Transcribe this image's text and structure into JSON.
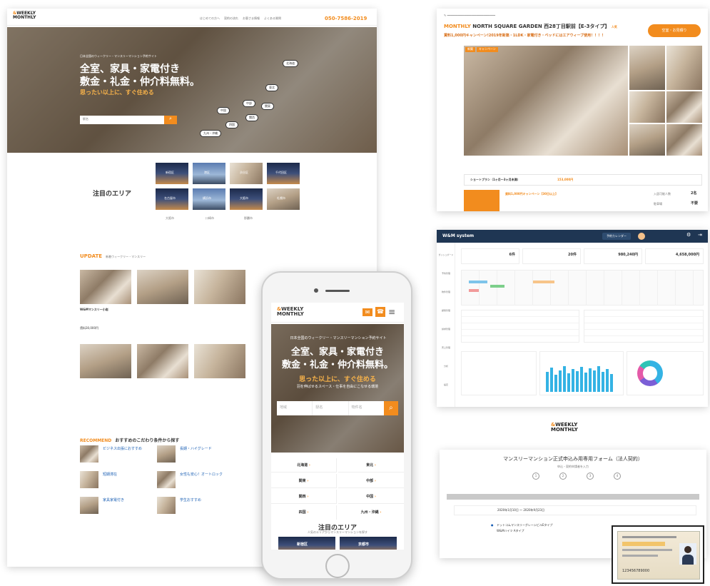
{
  "colors": {
    "accent": "#f28c1e",
    "dark": "#1f3653",
    "brand_orange": "#f28c1e"
  },
  "desktop": {
    "logo_top": "WEEKLY",
    "logo_bottom": "MONTHLY",
    "nav": [
      "はじめての方へ",
      "契約の流れ",
      "お客さま情報",
      "よくある質問"
    ],
    "phone": "050-7586-2019",
    "hero_small": "日本全国のウィークリー・マンスリーマンション予約サイト",
    "hero_line1": "全室、家具・家電付き",
    "hero_line2": "敷金・礼金・仲介料無料。",
    "hero_sub": "思ったい以上に、すぐ住める",
    "search_placeholder": "駅名",
    "map_pins": [
      "北海道",
      "東北",
      "関東",
      "中部",
      "関西",
      "中国",
      "四国",
      "九州・沖縄"
    ],
    "area_title": "注目のエリア",
    "area_tiles": [
      "新宿区",
      "港区",
      "渋谷区",
      "千代田区",
      "名古屋市",
      "横浜市",
      "大阪市",
      "札幌市"
    ],
    "area_links": [
      "大阪市",
      "川崎市",
      "那覇市"
    ],
    "update_label": "UPDATE",
    "update_title": "新着ウィークリー・マンスリー",
    "listing_name": "W&Mマンスリー小岩",
    "listing_price": "賃料30,000円",
    "recommend_label": "RECOMMEND",
    "recommend_title": "おすすめのこだわり条件から探す",
    "rec_items": [
      "ビジネス出張におすすめ",
      "長期・ハイグレード",
      "短期滞在",
      "女性も安心！オートロック",
      "家具家電付き",
      "学生おすすめ"
    ]
  },
  "mobile": {
    "logo_top": "WEEKLY",
    "logo_bottom": "MONTHLY",
    "hero_small": "日本全国のウィークリー・マンスリーマンション予約サイト",
    "hero_line1": "全室、家具・家電付き",
    "hero_line2": "敷金・礼金・仲介料無料。",
    "hero_sub": "思った以上に、すぐ住める",
    "hero_caption": "羽を伸ばせるスペース・仕事を自由にこなせる環境",
    "search_fields": [
      "地域",
      "駅名",
      "物件名"
    ],
    "regions": [
      [
        "北海道",
        "東北"
      ],
      [
        "関東",
        "中部"
      ],
      [
        "関西",
        "中国"
      ],
      [
        "四国",
        "九州・沖縄"
      ]
    ],
    "area_title": "注目のエリア",
    "area_sub": "人気のエリアからマンスリーマンションを探す",
    "area_tiles": [
      "新宿区",
      "京都市"
    ]
  },
  "detail": {
    "label": "MONTHLY",
    "title": "NORTH SQUARE GARDEN 西28丁目駅前【E-3タイプ】",
    "badge": "人気",
    "promo": "賃料1,000円キャンペーン!2019年新築・1LDK・家電付き・ベッドにはエアウィーブ使用！！！！",
    "cta": "空室・お見積り",
    "tags": [
      "新築",
      "キャンペーン"
    ],
    "plan_label": "ショートプラン（1ヶ月〜3ヶ月未満）",
    "plan_price": "153,000円",
    "campaign": "賃料1,000円キャンペーン【30日以上】",
    "side_rows": [
      [
        "入居可能人数",
        "2名"
      ],
      [
        "駐車場",
        "不要"
      ]
    ]
  },
  "admin": {
    "brand": "W&M system",
    "nav_button": "予約カレンダー",
    "stats": [
      [
        "6件",
        ""
      ],
      [
        "20件",
        ""
      ],
      [
        "980,240円",
        ""
      ],
      [
        "4,658,000円",
        ""
      ]
    ],
    "sidebar": [
      "ダッシュボード",
      "予約管理",
      "物件管理",
      "顧客管理",
      "請求管理",
      "売上管理",
      "分析",
      "設定"
    ]
  },
  "form": {
    "logo_top": "WEEKLY",
    "logo_bottom": "MONTHLY",
    "title": "マンスリーマンション正式申込み用専用フォーム（法人契約）",
    "steps_label": "申込・契約申請者を入力",
    "steps": [
      "1",
      "2",
      "3",
      "4"
    ],
    "date_range": "2020年1月10日 〜 2020年9月23日",
    "property": "ドットコムマンスリーグレーシビルEタイプ",
    "room": "W&Mハイツ Aタイプ",
    "license_number": "123456789000"
  }
}
